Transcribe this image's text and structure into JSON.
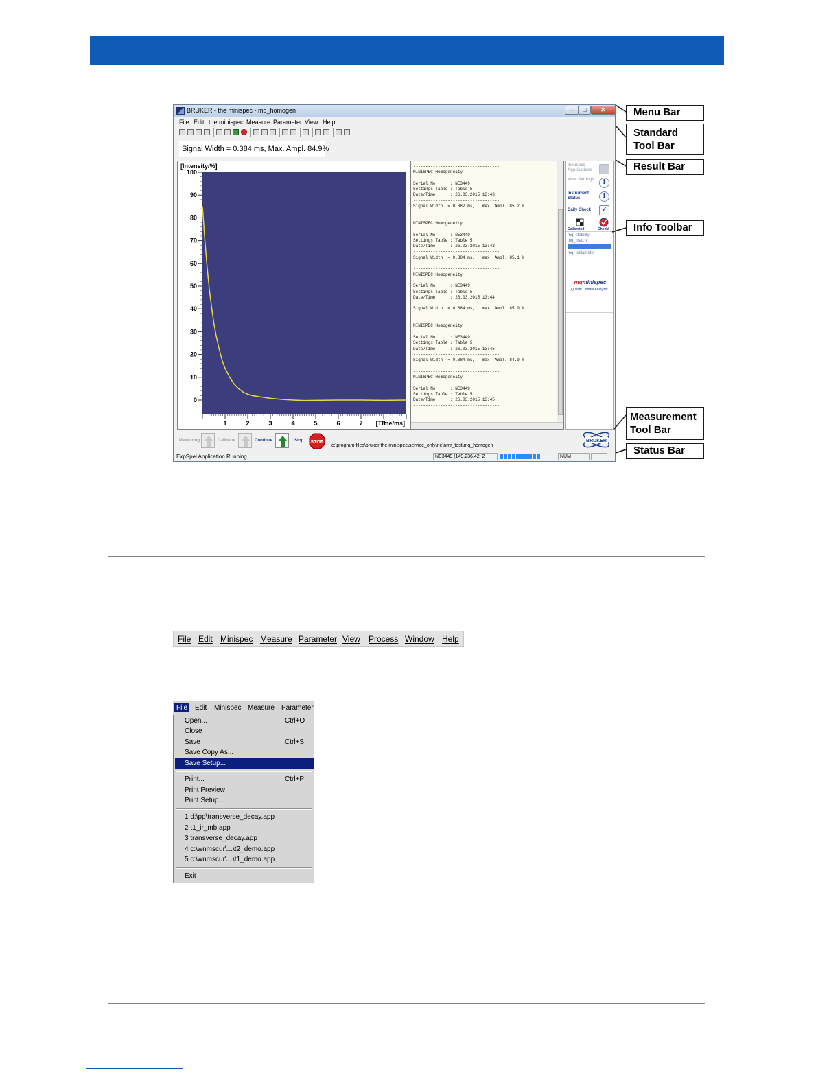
{
  "app": {
    "title": "BRUKER - the minispec - mq_homogen",
    "min_glyph": "—",
    "max_glyph": "□",
    "close_glyph": "✕",
    "menu": [
      "File",
      "Edit",
      "the minispec",
      "Measure",
      "Parameter",
      "View",
      "Help"
    ],
    "result_text": "Signal Width = 0.384 ms, Max. Ampl. 84.9%",
    "chart_ylabel": "[Intensity/%]",
    "log_lines": "-----------------------------------\nMINISPEC Homogeneity\n\nSerial No      : NE3449\nSettings Table : Table 5\nDate/Time      : 26.03.2015 13:43\n-----------------------------------\nSignal Width  = 0.382 ms,   max. Ampl. 85.2 %\n\n-----------------------------------\nMINISPEC Homogeneity\n\nSerial No      : NE3449\nSettings Table : Table 5\nDate/Time      : 26.03.2015 13:43\n-----------------------------------\nSignal Width  = 0.384 ms,   max. Ampl. 85.1 %\n\n-----------------------------------\nMINISPEC Homogeneity\n\nSerial No      : NE3449\nSettings Table : Table 5\nDate/Time      : 26.03.2015 13:44\n-----------------------------------\nSignal Width  = 0.384 ms,   max. Ampl. 85.0 %\n\n-----------------------------------\nMINISPEC Homogeneity\n\nSerial No      : NE3449\nSettings Table : Table 5\nDate/Time      : 26.03.2015 13:45\n-----------------------------------\nSignal Width  = 0.384 ms,   max. Ampl. 84.9 %\n\n-----------------------------------\nMINISPEC Homogeneity\n\nSerial No      : NE3449\nSettings Table : Table 5\nDate/Time      : 26.03.2015 13:45\n-----------------------------------",
    "info_toolbar": {
      "applications": "minispec Applications",
      "view_settings": "View Settings",
      "instrument_status": "Instrument Status",
      "daily_check": "Daily Check",
      "calibrated": "Calibrated",
      "check": "Check!",
      "info_glyph": "i",
      "check_glyph": "✓",
      "apps": [
        "mq_stability",
        "mq_match",
        "",
        "mq_teslameter"
      ],
      "logo_prefix": "mq",
      "logo": "minispec",
      "logo_sub": "Quality Control Analyzer"
    },
    "measurement_toolbar": {
      "measuring": "Measuring",
      "calibrate": "Calibrate",
      "continue": "Continue",
      "stop": "Stop",
      "stop_sign": "STOP",
      "path": "c:\\program files\\bruker the minispec\\service_only\\ne\\nmr_test\\mq_homogen",
      "logo": "BRUKER"
    },
    "status_bar": {
      "message": "ExpSpel Application Running...",
      "connection": "NE3449 (149.236.42. 2",
      "progress": 0.9,
      "num": "NUM"
    }
  },
  "callouts": {
    "menu_bar": "Menu Bar",
    "standard_toolbar_1": "Standard",
    "standard_toolbar_2": "Tool Bar",
    "result_bar": "Result Bar",
    "info_toolbar": "Info Toolbar",
    "measurement_toolbar_1": "Measurement",
    "measurement_toolbar_2": "Tool Bar",
    "status_bar": "Status Bar"
  },
  "menu_strip": [
    "File",
    "Edit",
    "Minispec",
    "Measure",
    "Parameter",
    "View",
    "Process",
    "Window",
    "Help"
  ],
  "file_menu": {
    "bar": [
      "File",
      "Edit",
      "Minispec",
      "Measure",
      "Parameter"
    ],
    "items": [
      {
        "label": "Open...",
        "shortcut": "Ctrl+O"
      },
      {
        "label": "Close",
        "shortcut": ""
      },
      {
        "label": "Save",
        "shortcut": "Ctrl+S"
      },
      {
        "label": "Save Copy As...",
        "shortcut": ""
      },
      {
        "label": "Save Setup...",
        "shortcut": "",
        "selected": true
      },
      {
        "label": "Print...",
        "shortcut": "Ctrl+P"
      },
      {
        "label": "Print Preview",
        "shortcut": ""
      },
      {
        "label": "Print Setup...",
        "shortcut": ""
      },
      {
        "label": "1 d:\\pp\\transverse_decay.app",
        "shortcut": ""
      },
      {
        "label": "2 t1_ir_mb.app",
        "shortcut": ""
      },
      {
        "label": "3 transverse_decay.app",
        "shortcut": ""
      },
      {
        "label": "4 c:\\wnmscur\\...\\t2_demo.app",
        "shortcut": ""
      },
      {
        "label": "5 c:\\wnmscur\\...\\t1_demo.app",
        "shortcut": ""
      },
      {
        "label": "Exit",
        "shortcut": ""
      }
    ]
  },
  "chart_data": {
    "type": "line",
    "ylabel": "[Intensity/%]",
    "xlabel": "[Time/ms]",
    "ylim": [
      0,
      100
    ],
    "xlim": [
      0,
      9
    ],
    "yticks": [
      0,
      10,
      20,
      30,
      40,
      50,
      60,
      70,
      80,
      90,
      100
    ],
    "xticks": [
      1,
      2,
      3,
      4,
      5,
      6,
      7,
      8
    ],
    "series": [
      {
        "color": "#e8d84a",
        "x": [
          0.0,
          0.1,
          0.2,
          0.3,
          0.4,
          0.5,
          0.6,
          0.7,
          0.8,
          0.9,
          1.0,
          1.2,
          1.4,
          1.6,
          1.8,
          2.0,
          2.2,
          2.5,
          3.0,
          3.5,
          4.0,
          4.5,
          5.0,
          6.0,
          7.0,
          8.0,
          9.0
        ],
        "y": [
          85,
          71,
          59,
          49,
          41,
          34,
          28.5,
          24,
          20,
          16.5,
          14,
          10,
          7,
          5,
          3.5,
          2.6,
          2,
          1.5,
          0.8,
          0.3,
          0,
          -0.2,
          -0.1,
          0,
          0,
          -0.1,
          0
        ]
      }
    ],
    "background": "#3b3d7c"
  }
}
